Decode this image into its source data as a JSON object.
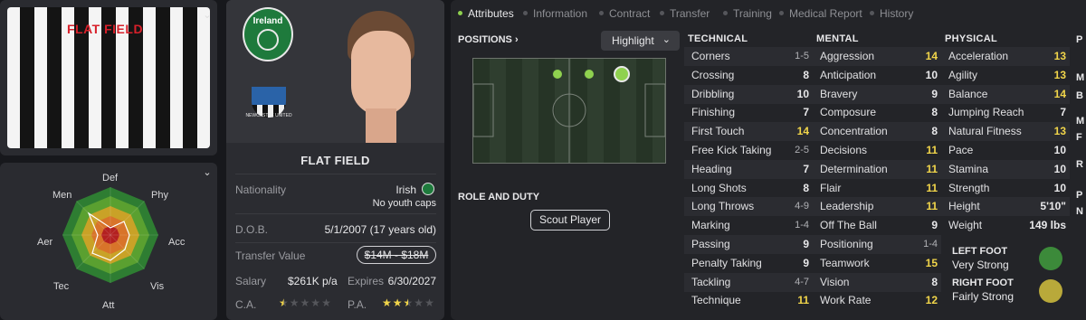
{
  "kit": {
    "name": "FLAT FIELD"
  },
  "radar": {
    "labels": [
      "Def",
      "Phy",
      "Acc",
      "Vis",
      "Att",
      "Tec",
      "Aer",
      "Men"
    ]
  },
  "player": {
    "name": "FLAT FIELD",
    "nation_badge": "Ireland",
    "club_badge": "NEWCASTLE UNITED",
    "info": {
      "nationality_label": "Nationality",
      "nationality": "Irish",
      "caps": "No youth caps",
      "dob_label": "D.O.B.",
      "dob": "5/1/2007 (17 years old)",
      "value_label": "Transfer Value",
      "value": "$14M - $18M",
      "salary_label": "Salary",
      "salary": "$261K p/a",
      "expires_label": "Expires",
      "expires": "6/30/2027",
      "ca_label": "C.A.",
      "pa_label": "P.A.",
      "ca_stars": 0.5,
      "pa_stars": 2.5
    }
  },
  "tabs": [
    "Attributes",
    "Information",
    "Contract",
    "Transfer",
    "Training",
    "Medical Report",
    "History"
  ],
  "positions": {
    "heading": "POSITIONS",
    "highlight": "Highlight",
    "role_heading": "ROLE AND DUTY",
    "scout": "Scout Player"
  },
  "technical": {
    "heading": "TECHNICAL",
    "rows": [
      {
        "name": "Corners",
        "range": "1-5",
        "value": ""
      },
      {
        "name": "Crossing",
        "range": "",
        "value": "8"
      },
      {
        "name": "Dribbling",
        "range": "",
        "value": "10"
      },
      {
        "name": "Finishing",
        "range": "",
        "value": "7"
      },
      {
        "name": "First Touch",
        "range": "",
        "value": "14"
      },
      {
        "name": "Free Kick Taking",
        "range": "2-5",
        "value": ""
      },
      {
        "name": "Heading",
        "range": "",
        "value": "7"
      },
      {
        "name": "Long Shots",
        "range": "",
        "value": "8"
      },
      {
        "name": "Long Throws",
        "range": "4-9",
        "value": ""
      },
      {
        "name": "Marking",
        "range": "1-4",
        "value": ""
      },
      {
        "name": "Passing",
        "range": "",
        "value": "9"
      },
      {
        "name": "Penalty Taking",
        "range": "",
        "value": "9"
      },
      {
        "name": "Tackling",
        "range": "4-7",
        "value": ""
      },
      {
        "name": "Technique",
        "range": "",
        "value": "11"
      }
    ]
  },
  "mental": {
    "heading": "MENTAL",
    "rows": [
      {
        "name": "Aggression",
        "range": "",
        "value": "14"
      },
      {
        "name": "Anticipation",
        "range": "",
        "value": "10"
      },
      {
        "name": "Bravery",
        "range": "",
        "value": "9"
      },
      {
        "name": "Composure",
        "range": "",
        "value": "8"
      },
      {
        "name": "Concentration",
        "range": "",
        "value": "8"
      },
      {
        "name": "Decisions",
        "range": "",
        "value": "11"
      },
      {
        "name": "Determination",
        "range": "",
        "value": "11"
      },
      {
        "name": "Flair",
        "range": "",
        "value": "11"
      },
      {
        "name": "Leadership",
        "range": "",
        "value": "11"
      },
      {
        "name": "Off The Ball",
        "range": "",
        "value": "9"
      },
      {
        "name": "Positioning",
        "range": "1-4",
        "value": ""
      },
      {
        "name": "Teamwork",
        "range": "",
        "value": "15"
      },
      {
        "name": "Vision",
        "range": "",
        "value": "8"
      },
      {
        "name": "Work Rate",
        "range": "",
        "value": "12"
      }
    ]
  },
  "physical": {
    "heading": "PHYSICAL",
    "rows": [
      {
        "name": "Acceleration",
        "range": "",
        "value": "13"
      },
      {
        "name": "Agility",
        "range": "",
        "value": "13"
      },
      {
        "name": "Balance",
        "range": "",
        "value": "14"
      },
      {
        "name": "Jumping Reach",
        "range": "",
        "value": "7"
      },
      {
        "name": "Natural Fitness",
        "range": "",
        "value": "13"
      },
      {
        "name": "Pace",
        "range": "",
        "value": "10"
      },
      {
        "name": "Stamina",
        "range": "",
        "value": "10"
      },
      {
        "name": "Strength",
        "range": "",
        "value": "10"
      },
      {
        "name": "Height",
        "range": "",
        "value": "5'10\""
      },
      {
        "name": "Weight",
        "range": "",
        "value": "149 lbs"
      }
    ],
    "left_foot_label": "LEFT FOOT",
    "left_foot": "Very Strong",
    "right_foot_label": "RIGHT FOOT",
    "right_foot": "Fairly Strong"
  },
  "side_letters": [
    "P",
    "M",
    "B",
    "M",
    "F",
    "R",
    "P",
    "N"
  ],
  "colors": {
    "highlight": "#f1d54a",
    "accent": "#8fd14f"
  }
}
